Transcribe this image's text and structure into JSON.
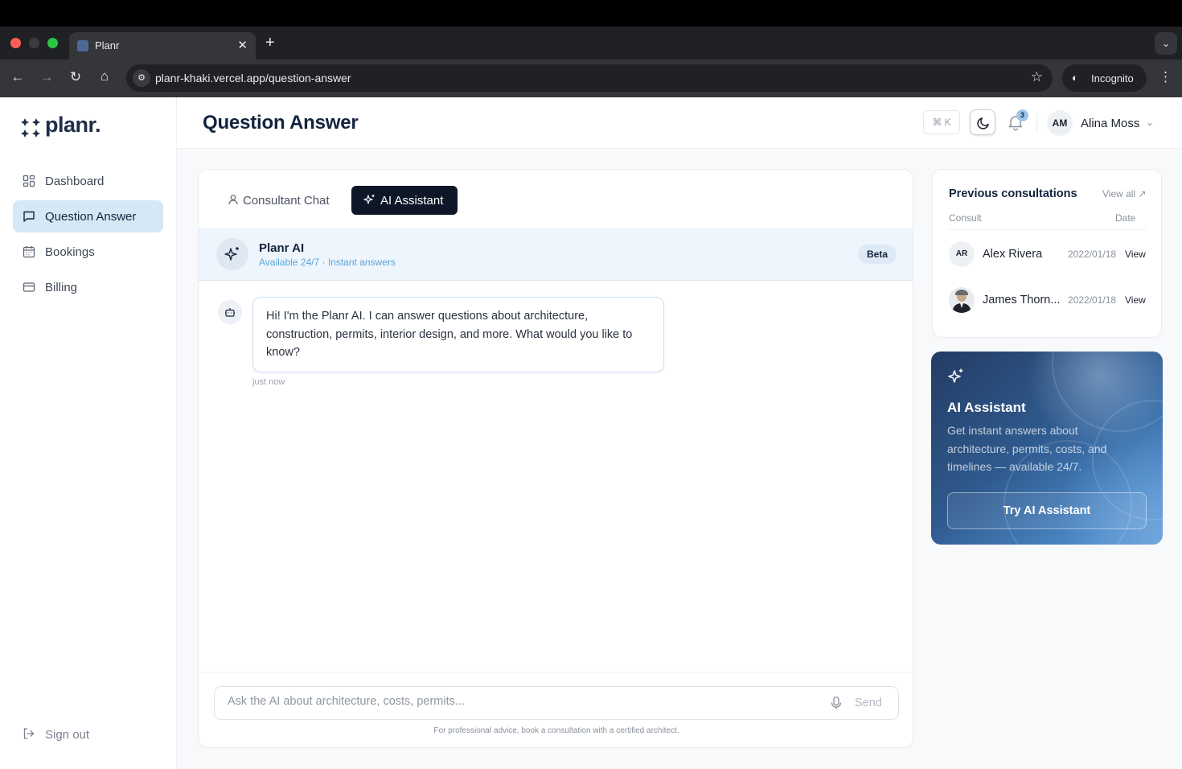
{
  "browser": {
    "tab_title": "Planr",
    "url": "planr-khaki.vercel.app/question-answer",
    "incognito_label": "Incognito"
  },
  "app": {
    "logo_text": "planr.",
    "brand_color": "#1e2e47",
    "accent_color": "#d6e7f6"
  },
  "sidebar": {
    "items": [
      {
        "label": "Dashboard",
        "icon": "dashboard-icon"
      },
      {
        "label": "Question Answer",
        "icon": "chat-icon",
        "active": true
      },
      {
        "label": "Bookings",
        "icon": "calendar-icon"
      },
      {
        "label": "Billing",
        "icon": "card-icon"
      }
    ],
    "signout_label": "Sign out"
  },
  "header": {
    "title": "Question Answer",
    "shortcut": "⌘ K",
    "notification_count": "3",
    "user_initials": "AM",
    "user_name": "Alina Moss"
  },
  "chat": {
    "tabs": [
      "Consultant Chat",
      "AI Assistant"
    ],
    "active_tab": "AI Assistant",
    "assistant_name": "Planr AI",
    "assistant_status": "Available 24/7 · Instant answers",
    "badge": "Beta",
    "messages": [
      {
        "from": "bot",
        "text": "Hi! I'm the Planr AI. I can answer questions about architecture, construction, permits, interior design, and more. What would you like to know?",
        "time": "just now"
      }
    ],
    "input_placeholder": "Ask the AI about architecture, costs, permits...",
    "send_label": "Send",
    "disclaimer": "For professional advice, book a consultation with a certified architect."
  },
  "previous": {
    "title": "Previous consultations",
    "view_all": "View all ↗",
    "col_consult": "Consult",
    "col_date": "Date",
    "rows": [
      {
        "initials": "AR",
        "name": "Alex Rivera",
        "date": "2022/01/18",
        "action": "View"
      },
      {
        "initials": "",
        "name": "James Thorn...",
        "date": "2022/01/18",
        "action": "View"
      }
    ]
  },
  "promo": {
    "title": "AI Assistant",
    "description": "Get instant answers about architecture, permits, costs, and timelines — available 24/7.",
    "button": "Try AI Assistant"
  }
}
